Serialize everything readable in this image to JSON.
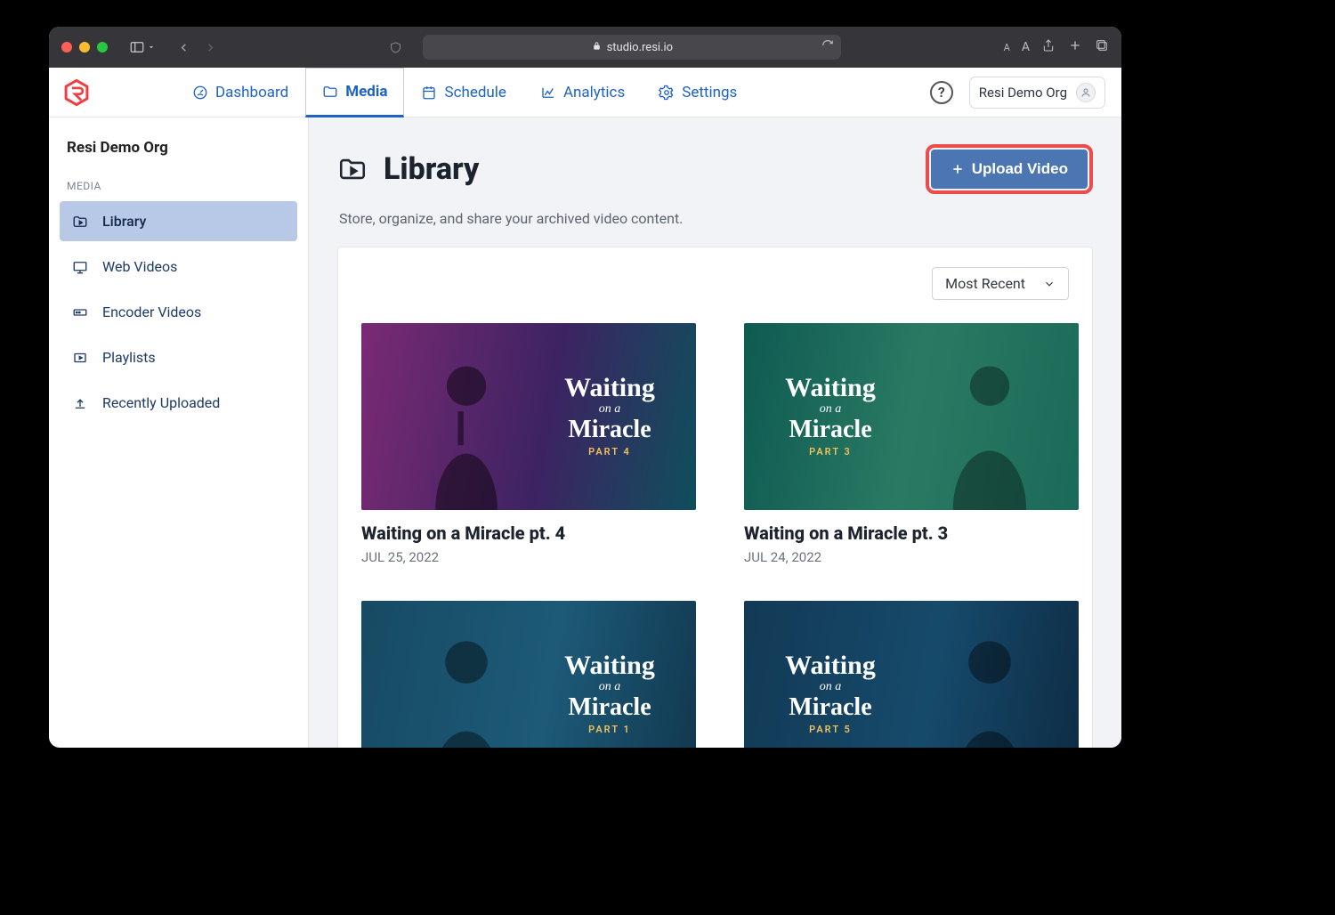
{
  "browser": {
    "url": "studio.resi.io"
  },
  "nav": {
    "items": [
      {
        "label": "Dashboard",
        "icon": "gauge"
      },
      {
        "label": "Media",
        "icon": "folder",
        "active": true
      },
      {
        "label": "Schedule",
        "icon": "calendar"
      },
      {
        "label": "Analytics",
        "icon": "chart"
      },
      {
        "label": "Settings",
        "icon": "gear"
      }
    ]
  },
  "org": {
    "name": "Resi Demo Org"
  },
  "sidebar": {
    "org": "Resi Demo Org",
    "section": "MEDIA",
    "items": [
      {
        "label": "Library",
        "active": true
      },
      {
        "label": "Web Videos"
      },
      {
        "label": "Encoder Videos"
      },
      {
        "label": "Playlists"
      },
      {
        "label": "Recently Uploaded"
      }
    ]
  },
  "page": {
    "title": "Library",
    "subtitle": "Store, organize, and share your archived video content.",
    "upload_label": "Upload Video",
    "sort_label": "Most Recent"
  },
  "videos": [
    {
      "title": "Waiting on a Miracle pt. 4",
      "date": "JUL 25, 2022",
      "part": "PART 4",
      "grad": "g1"
    },
    {
      "title": "Waiting on a Miracle pt. 3",
      "date": "JUL 24, 2022",
      "part": "PART 3",
      "grad": "g2"
    },
    {
      "title": "",
      "date": "",
      "part": "PART 1",
      "grad": "g3"
    },
    {
      "title": "",
      "date": "",
      "part": "PART 5",
      "grad": "g4"
    }
  ],
  "thumb_text": {
    "line1": "Waiting",
    "line2": "on a",
    "line3": "Miracle"
  }
}
